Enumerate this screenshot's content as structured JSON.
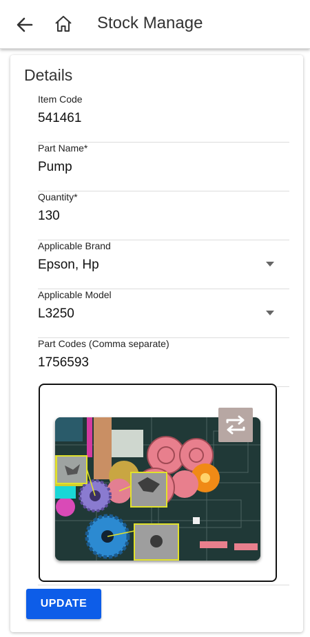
{
  "appbar": {
    "title": "Stock Manage",
    "icons": {
      "back": "arrow-left-icon",
      "home": "home-icon"
    }
  },
  "card": {
    "heading": "Details",
    "fields": [
      {
        "label": "Item Code",
        "value": "541461"
      },
      {
        "label": "Part Name*",
        "value": "Pump"
      },
      {
        "label": "Quantity*",
        "value": "130"
      },
      {
        "label": "Applicable Brand",
        "value": "Epson, Hp",
        "dropdown": true
      },
      {
        "label": "Applicable Model",
        "value": "L3250",
        "dropdown": true
      },
      {
        "label": "Part Codes (Comma separate)",
        "value": "1756593"
      }
    ],
    "image": {
      "swap_icon": "swap-icon"
    },
    "update_label": "UPDATE"
  },
  "colors": {
    "primary": "#0d5de8",
    "swap_bg": "#b7a7a3"
  }
}
